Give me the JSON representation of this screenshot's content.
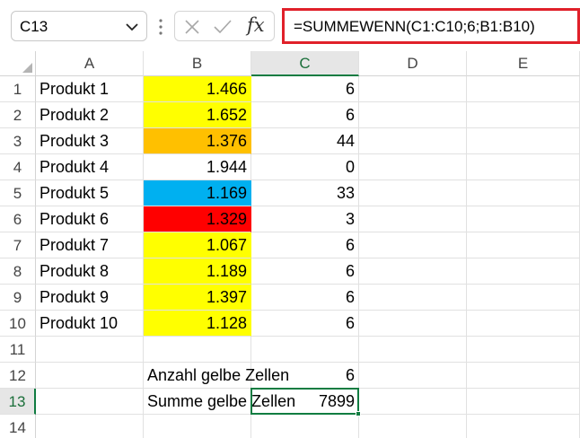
{
  "name_box": {
    "value": "C13"
  },
  "formula_bar": {
    "value": "=SUMMEWENN(C1:C10;6;B1:B10)",
    "fx_label": "fx"
  },
  "columns": [
    "A",
    "B",
    "C",
    "D",
    "E"
  ],
  "selected_column": "C",
  "rows": [
    {
      "num": "1",
      "a": "Produkt 1",
      "b": "1.466",
      "c": "6",
      "b_fill": "#ffff00"
    },
    {
      "num": "2",
      "a": "Produkt 2",
      "b": "1.652",
      "c": "6",
      "b_fill": "#ffff00"
    },
    {
      "num": "3",
      "a": "Produkt 3",
      "b": "1.376",
      "c": "44",
      "b_fill": "#ffc000"
    },
    {
      "num": "4",
      "a": "Produkt 4",
      "b": "1.944",
      "c": "0",
      "b_fill": "#ffffff"
    },
    {
      "num": "5",
      "a": "Produkt 5",
      "b": "1.169",
      "c": "33",
      "b_fill": "#00b0f0"
    },
    {
      "num": "6",
      "a": "Produkt 6",
      "b": "1.329",
      "c": "3",
      "b_fill": "#ff0000"
    },
    {
      "num": "7",
      "a": "Produkt 7",
      "b": "1.067",
      "c": "6",
      "b_fill": "#ffff00"
    },
    {
      "num": "8",
      "a": "Produkt 8",
      "b": "1.189",
      "c": "6",
      "b_fill": "#ffff00"
    },
    {
      "num": "9",
      "a": "Produkt 9",
      "b": "1.397",
      "c": "6",
      "b_fill": "#ffff00"
    },
    {
      "num": "10",
      "a": "Produkt 10",
      "b": "1.128",
      "c": "6",
      "b_fill": "#ffff00"
    },
    {
      "num": "11",
      "a": "",
      "b": "",
      "c": "",
      "b_fill": "#ffffff"
    },
    {
      "num": "12",
      "a": "",
      "b": "Anzahl gelbe Zellen",
      "c": "6",
      "b_fill": "#ffffff"
    },
    {
      "num": "13",
      "a": "",
      "b": "Summe gelbe Zellen",
      "c": "7899",
      "b_fill": "#ffffff"
    },
    {
      "num": "14",
      "a": "",
      "b": "",
      "c": "",
      "b_fill": "#ffffff"
    }
  ],
  "active_cell": "C13",
  "colors": {
    "accent": "#107c41",
    "formula_highlight": "#e0202a"
  }
}
